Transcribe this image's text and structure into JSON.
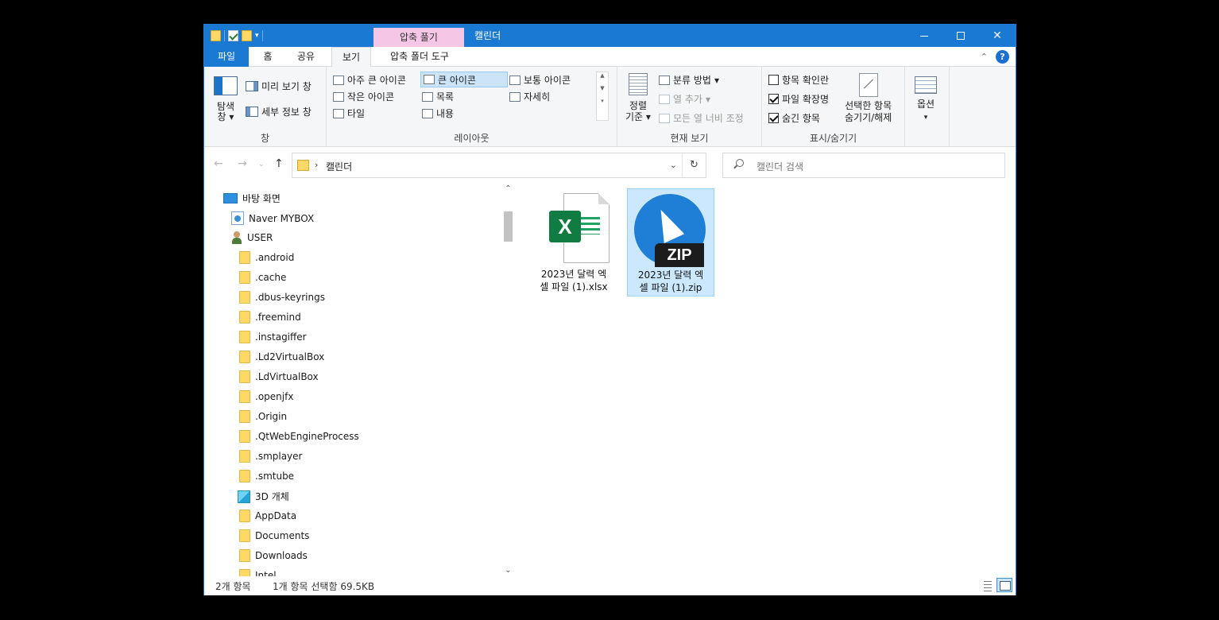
{
  "window": {
    "title": "캘린더",
    "context_tab": "압축 풀기"
  },
  "ribbon_tabs": {
    "file": "파일",
    "home": "홈",
    "share": "공유",
    "view": "보기",
    "zip_tools": "압축 폴더 도구"
  },
  "ribbon": {
    "panes": {
      "nav_pane": "탐색\n창",
      "nav_pane_line1": "탐색",
      "nav_pane_line2": "창",
      "preview_pane": "미리 보기 창",
      "details_pane": "세부 정보 창",
      "label": "창"
    },
    "layout": {
      "extra_large": "아주 큰 아이콘",
      "large": "큰 아이콘",
      "medium": "보통 아이콘",
      "small": "작은 아이콘",
      "list": "목록",
      "details": "자세히",
      "tiles": "타일",
      "content": "내용",
      "label": "레이아웃"
    },
    "current_view": {
      "sort_line1": "정렬",
      "sort_line2": "기준",
      "group_by": "분류 방법",
      "add_columns": "열 추가",
      "size_all_columns": "모든 열 너비 조정",
      "label": "현재 보기"
    },
    "show_hide": {
      "item_check_boxes": "항목 확인란",
      "file_extensions": "파일 확장명",
      "hidden_items": "숨긴 항목",
      "hide_selected_line1": "선택한 항목",
      "hide_selected_line2": "숨기기/해제",
      "label": "표시/숨기기",
      "item_check_boxes_checked": false,
      "file_extensions_checked": true,
      "hidden_items_checked": true
    },
    "options": "옵션"
  },
  "address": {
    "path": "캘린더",
    "search_placeholder": "캘린더 검색"
  },
  "nav_tree": [
    {
      "label": "바탕 화면",
      "icon": "desktop-icon"
    },
    {
      "label": "Naver MYBOX",
      "icon": "mybox-icon"
    },
    {
      "label": "USER",
      "icon": "user-icon"
    },
    {
      "label": ".android",
      "icon": "folder-icon"
    },
    {
      "label": ".cache",
      "icon": "folder-icon"
    },
    {
      "label": ".dbus-keyrings",
      "icon": "folder-icon"
    },
    {
      "label": ".freemind",
      "icon": "folder-icon"
    },
    {
      "label": ".instagiffer",
      "icon": "folder-icon"
    },
    {
      "label": ".Ld2VirtualBox",
      "icon": "folder-icon"
    },
    {
      "label": ".LdVirtualBox",
      "icon": "folder-icon"
    },
    {
      "label": ".openjfx",
      "icon": "folder-icon"
    },
    {
      "label": ".Origin",
      "icon": "folder-icon"
    },
    {
      "label": ".QtWebEngineProcess",
      "icon": "folder-icon"
    },
    {
      "label": ".smplayer",
      "icon": "folder-icon"
    },
    {
      "label": ".smtube",
      "icon": "folder-icon"
    },
    {
      "label": "3D 개체",
      "icon": "3d-objects-icon"
    },
    {
      "label": "AppData",
      "icon": "folder-icon"
    },
    {
      "label": "Documents",
      "icon": "folder-icon"
    },
    {
      "label": "Downloads",
      "icon": "folder-icon"
    },
    {
      "label": "Intel",
      "icon": "folder-icon"
    }
  ],
  "files": [
    {
      "name_line1": "2023년 달력 엑",
      "name_line2": "셀 파일 (1).xlsx",
      "icon": "excel-file-icon",
      "selected": false
    },
    {
      "name_line1": "2023년 달력 엑",
      "name_line2": "셀 파일 (1).zip",
      "icon": "zip-file-icon",
      "selected": true
    }
  ],
  "file_icon_text": {
    "excel": "X",
    "zip": "ZIP"
  },
  "status": {
    "item_count": "2개 항목",
    "selection": "1개 항목 선택함 69.5KB"
  },
  "colors": {
    "titlebar": "#1979d3",
    "context_tab": "#f6c6e7",
    "selection": "#cce8ff"
  }
}
